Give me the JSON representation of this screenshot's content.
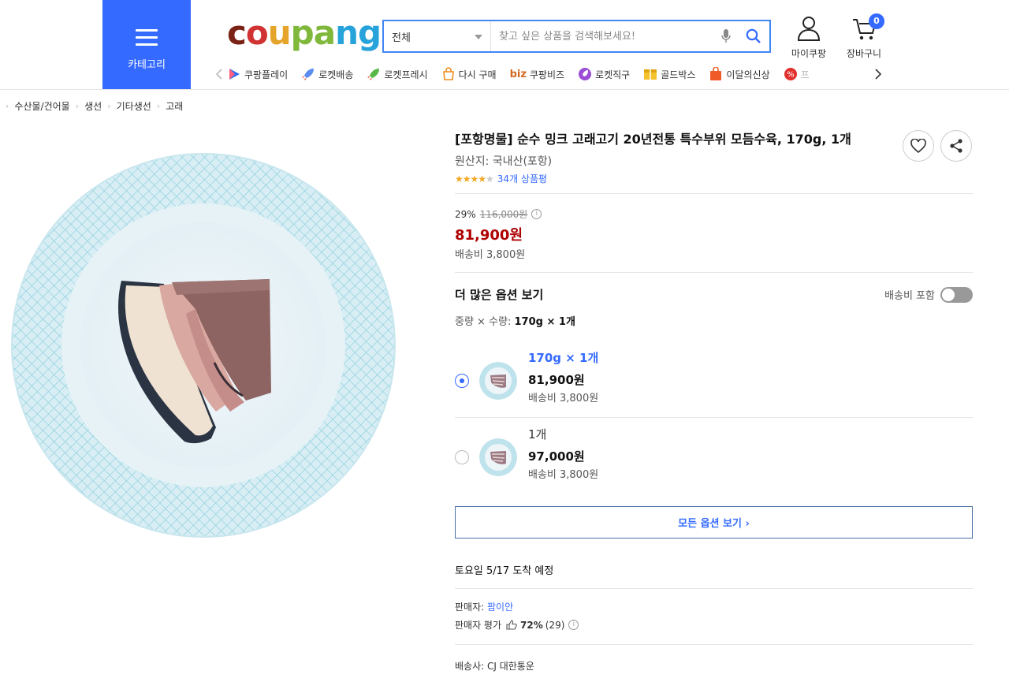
{
  "header": {
    "category_label": "카테고리",
    "logo": {
      "c1": "c",
      "c2": "o",
      "c3": "u",
      "c4": "pa",
      "c5": "ng"
    },
    "search": {
      "category": "전체",
      "placeholder": "찾고 싶은 상품을 검색해보세요!"
    },
    "my_coupang": "마이쿠팡",
    "cart": "장바구니",
    "cart_count": "0",
    "services": [
      "쿠팡플레이",
      "로켓배송",
      "로켓프레시",
      "다시 구매",
      "쿠팡비즈",
      "로켓직구",
      "골드박스",
      "이달의신상",
      "프"
    ],
    "biz_prefix": "biz"
  },
  "breadcrumb": [
    "수산물/건어물",
    "생선",
    "기타생선",
    "고래"
  ],
  "product": {
    "title": "[포항명물] 순수 밍크 고래고기 20년전통 특수부위 모듬수육, 170g, 1개",
    "origin": "원산지: 국내산(포항)",
    "rating": 4,
    "review_count": "34개 상품평",
    "discount": "29%",
    "original_price": "116,000원",
    "info_icon": "ⓘ",
    "price": "81,900원",
    "shipping": "배송비 3,800원"
  },
  "options": {
    "heading": "더 많은 옵션 보기",
    "shipping_toggle_label": "배송비 포함",
    "shipping_toggle_on": false,
    "summary_prefix": "중량 × 수량: ",
    "summary_value": "170g × 1개",
    "items": [
      {
        "name": "170g × 1개",
        "price": "81,900원",
        "shipping": "배송비 3,800원",
        "selected": true
      },
      {
        "name": "1개",
        "price": "97,000원",
        "shipping": "배송비 3,800원",
        "selected": false
      }
    ],
    "all_options_label": "모든 옵션 보기 ›"
  },
  "delivery": {
    "day": "토요일 5/17",
    "suffix": "도착 예정"
  },
  "seller": {
    "prefix": "판매자: ",
    "name": "팜이안",
    "rating_label": "판매자 평가",
    "rating_percent": "72%",
    "rating_count": "(29)"
  },
  "carrier": "배송사: CJ 대한통운",
  "colors": {
    "accent": "#346aff",
    "price": "#ae0000",
    "star": "#f5a623"
  }
}
